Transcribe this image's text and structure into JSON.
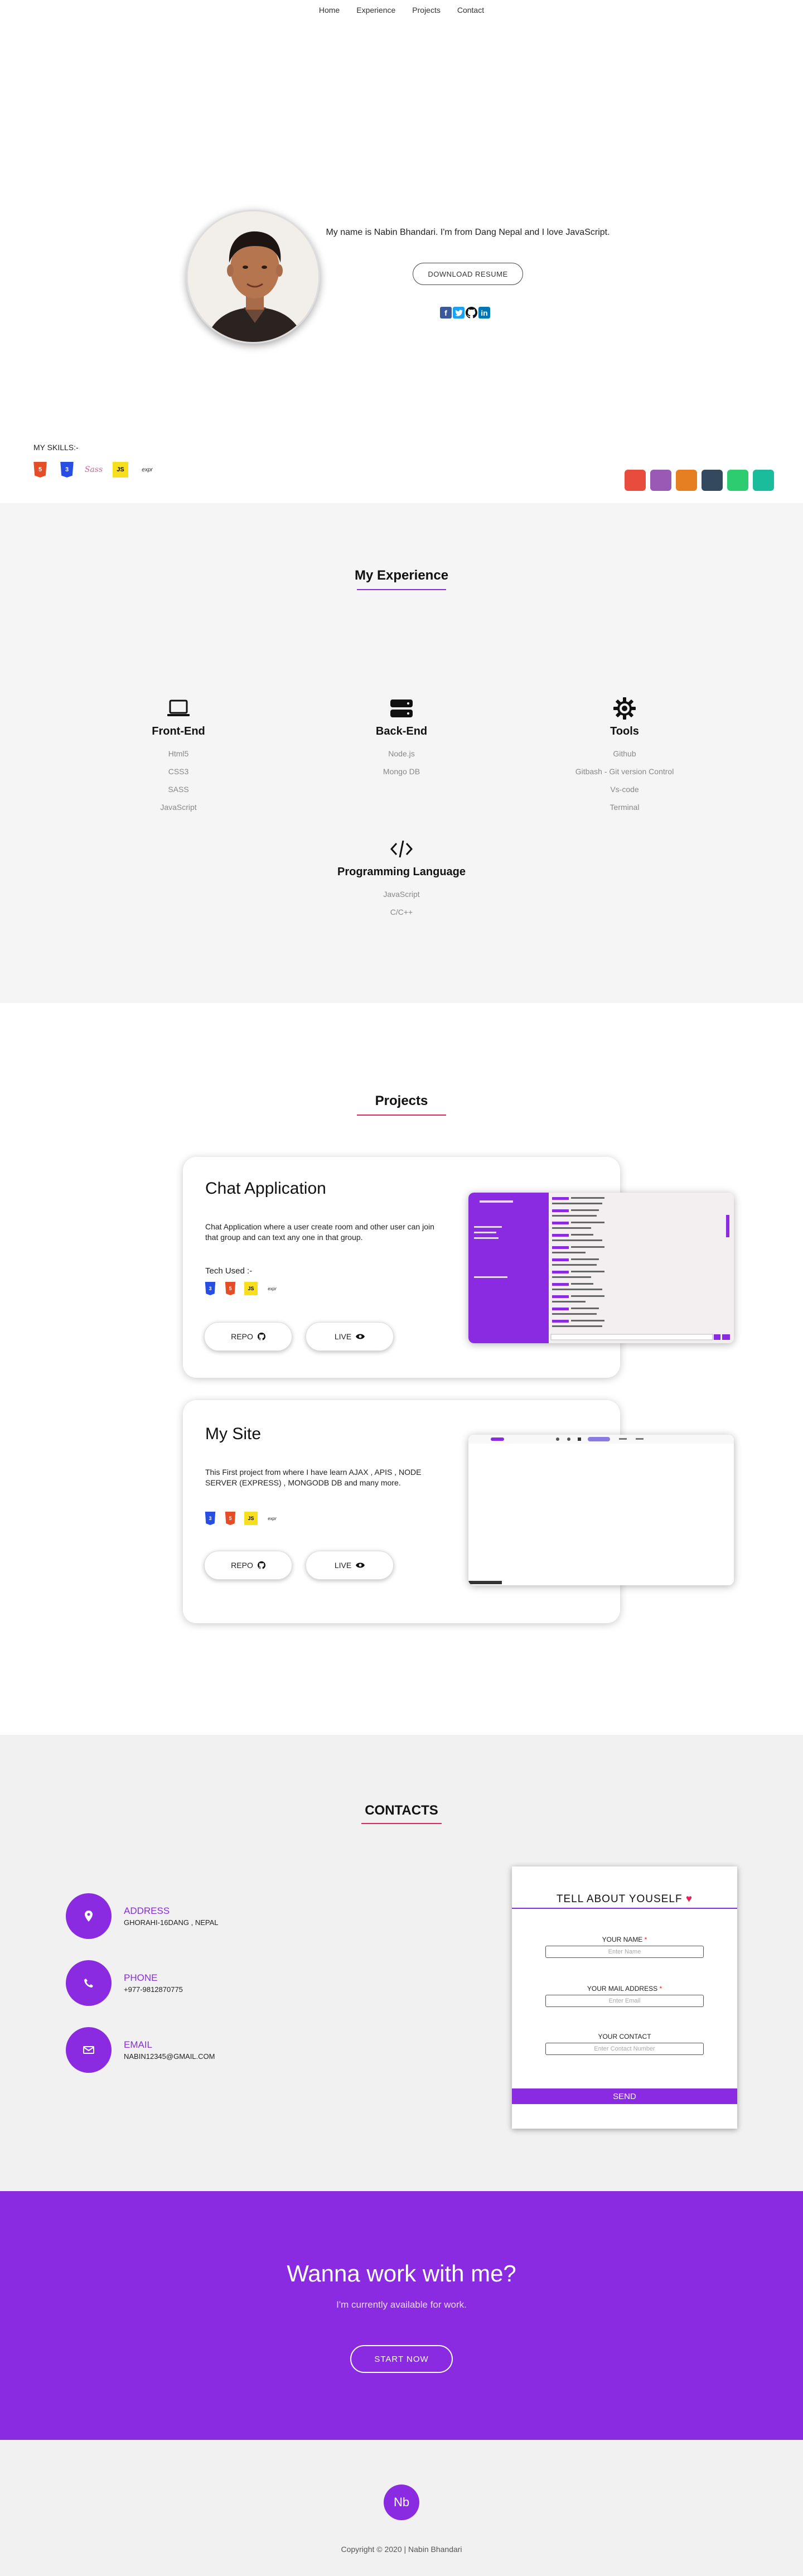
{
  "nav": {
    "items": [
      "Home",
      "Experience",
      "Projects",
      "Contact"
    ]
  },
  "hero": {
    "intro": "My name is Nabin Bhandari. I'm from Dang Nepal and I love JavaScript.",
    "resume_label": "DOWNLOAD RESUME",
    "socials": [
      "facebook-icon",
      "twitter-icon",
      "github-icon",
      "linkedin-icon"
    ],
    "skills_label": "MY SKILLS:-",
    "skill_icons": [
      "html5-icon",
      "css3-icon",
      "sass-icon",
      "javascript-icon",
      "express-icon"
    ],
    "html_glyph": "5",
    "css_glyph": "3",
    "sass_glyph": "Sass",
    "js_glyph": "JS",
    "express_glyph": "expr",
    "swatches": [
      "#e74c3c",
      "#9b59b6",
      "#e67e22",
      "#34495e",
      "#2ecc71",
      "#1abc9c"
    ]
  },
  "experience": {
    "title": "My Experience",
    "accent": "#8a2be2",
    "columns": [
      {
        "icon": "laptop-icon",
        "title": "Front-End",
        "items": [
          "Html5",
          "CSS3",
          "SASS",
          "JavaScript"
        ]
      },
      {
        "icon": "server-icon",
        "title": "Back-End",
        "items": [
          "Node.js",
          "Mongo DB"
        ]
      },
      {
        "icon": "gear-icon",
        "title": "Tools",
        "items": [
          "Github",
          "Gitbash - Git version Control",
          "Vs-code",
          "Terminal"
        ]
      },
      {
        "icon": "code-icon",
        "title": "Programming Language",
        "items": [
          "JavaScript",
          "C/C++"
        ]
      }
    ]
  },
  "projects": {
    "title": "Projects",
    "cards": [
      {
        "title": "Chat Application",
        "description": "Chat Application where a user create room and other user can join that group and can text any one in that group.",
        "tech_label": "Tech Used :-",
        "repo_label": "REPO",
        "live_label": "LIVE"
      },
      {
        "title": "My Site",
        "description": "This First project from where I have learn AJAX , APIS , NODE SERVER (EXPRESS) , MONGODB DB and many more.",
        "tech_label": "",
        "repo_label": "REPO",
        "live_label": "LIVE"
      }
    ]
  },
  "contacts": {
    "title": "CONTACTS",
    "items": [
      {
        "icon": "location-pin-icon",
        "label": "ADDRESS",
        "value": "GHORAHI-16DANG , NEPAL"
      },
      {
        "icon": "phone-icon",
        "label": "PHONE",
        "value": "+977-9812870775"
      },
      {
        "icon": "envelope-icon",
        "label": "EMAIL",
        "value": "NABIN12345@GMAIL.COM"
      }
    ],
    "form": {
      "heading": "TELL ABOUT YOUSELF",
      "heart": "♥",
      "name_label": "YOUR NAME",
      "name_placeholder": "Enter Name",
      "email_label": "YOUR MAIL ADDRESS",
      "email_placeholder": "Enter Email",
      "contact_label": "YOUR CONTACT",
      "contact_placeholder": "Enter Contact Number",
      "required_mark": "*",
      "send_label": "SEND"
    }
  },
  "cta": {
    "heading": "Wanna work with me?",
    "sub": "I'm currently available for work.",
    "button": "START NOW"
  },
  "footer": {
    "logo": "Nb",
    "copyright": "Copyright © 2020 | Nabin Bhandari"
  }
}
